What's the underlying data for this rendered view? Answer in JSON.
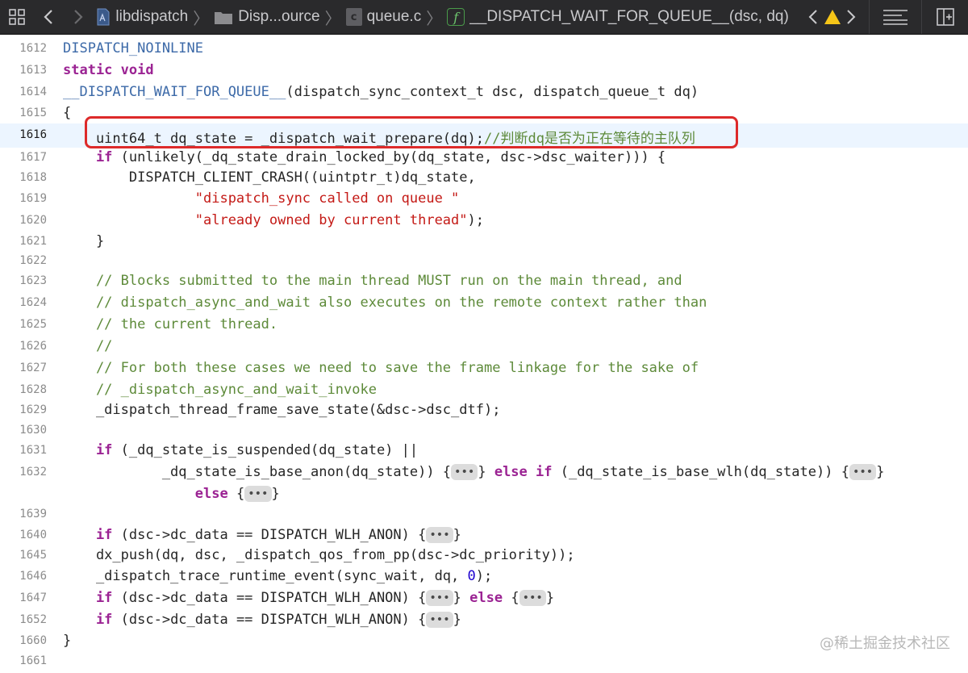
{
  "toolbar": {
    "breadcrumbs": [
      {
        "label": "libdispatch",
        "icon": "project-icon"
      },
      {
        "label": "Disp...ource",
        "icon": "folder-icon"
      },
      {
        "label": "queue.c",
        "icon": "c-file-icon"
      },
      {
        "label": "__DISPATCH_WAIT_FOR_QUEUE__(dsc, dq)",
        "icon": "function-icon"
      }
    ],
    "function_glyph": "f",
    "file_glyph": "c",
    "warning_glyph": "!"
  },
  "editor": {
    "line_numbers": [
      "1612",
      "1613",
      "1614",
      "1615",
      "1616",
      "1617",
      "1618",
      "1619",
      "1620",
      "1621",
      "1622",
      "1623",
      "1624",
      "1625",
      "1626",
      "1627",
      "1628",
      "1629",
      "1630",
      "1631",
      "1632",
      "",
      "1639",
      "1640",
      "1645",
      "1646",
      "1647",
      "1652",
      "1660",
      "1661"
    ],
    "active_line": "1616",
    "tokens": {
      "l1612": "DISPATCH_NOINLINE",
      "l1613": "static void",
      "l1614a": "__DISPATCH_WAIT_FOR_QUEUE__",
      "l1614b": "(dispatch_sync_context_t dsc, dispatch_queue_t dq)",
      "l1615": "{",
      "l1616a": "    uint64_t dq_state = _dispatch_wait_prepare(dq);",
      "l1616b": "//判断dq是否为正在等待的主队列",
      "l1617a": "    if",
      "l1617b": " (unlikely(_dq_state_drain_locked_by(dq_state, dsc->dsc_waiter))) {",
      "l1618": "        DISPATCH_CLIENT_CRASH((uintptr_t)dq_state,",
      "l1619": "                \"dispatch_sync called on queue \"",
      "l1620a": "                \"already owned by current thread\"",
      "l1620b": ");",
      "l1621": "    }",
      "l1622": "",
      "l1623": "    // Blocks submitted to the main thread MUST run on the main thread, and",
      "l1624": "    // dispatch_async_and_wait also executes on the remote context rather than",
      "l1625": "    // the current thread.",
      "l1626": "    //",
      "l1627": "    // For both these cases we need to save the frame linkage for the sake of",
      "l1628": "    // _dispatch_async_and_wait_invoke",
      "l1629": "    _dispatch_thread_frame_save_state(&dsc->dsc_dtf);",
      "l1630": "",
      "l1631a": "    if",
      "l1631b": " (_dq_state_is_suspended(dq_state) ||",
      "l1632a": "            _dq_state_is_base_anon(dq_state)) {",
      "l1632b": "} ",
      "l1632c": "else if",
      "l1632d": " (_dq_state_is_base_wlh(dq_state)) {",
      "l1632e": "}",
      "l1632f_indent": "                ",
      "l1632g": "else",
      "l1632h": " {",
      "l1632i": "}",
      "l1640a": "    if",
      "l1640b": " (dsc->dc_data == DISPATCH_WLH_ANON) {",
      "l1640c": "}",
      "l1645": "    dx_push(dq, dsc, _dispatch_qos_from_pp(dsc->dc_priority));",
      "l1646a": "    _dispatch_trace_runtime_event(sync_wait, dq, ",
      "l1646b": "0",
      "l1646c": ");",
      "l1647a": "    if",
      "l1647b": " (dsc->dc_data == DISPATCH_WLH_ANON) {",
      "l1647c": "} ",
      "l1647d": "else",
      "l1647e": " {",
      "l1647f": "}",
      "l1652a": "    if",
      "l1652b": " (dsc->dc_data == DISPATCH_WLH_ANON) {",
      "l1652c": "}",
      "l1660": "}"
    },
    "fold_label": "•••"
  },
  "watermark": "@稀土掘金技术社区",
  "colors": {
    "keyword": "#9b2393",
    "macro": "#3d6aa8",
    "string": "#c41a16",
    "comment": "#5d8a39",
    "highlight_border": "#dd2a2a"
  }
}
